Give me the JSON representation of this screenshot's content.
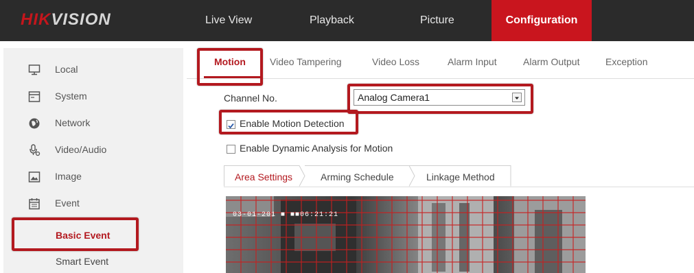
{
  "brand": {
    "logo_prefix": "HIK",
    "logo_suffix": "VISION"
  },
  "nav": {
    "live_view": "Live View",
    "playback": "Playback",
    "picture": "Picture",
    "configuration": "Configuration",
    "active": "configuration"
  },
  "sidebar": {
    "items": [
      {
        "label": "Local",
        "icon": "monitor-icon"
      },
      {
        "label": "System",
        "icon": "system-icon"
      },
      {
        "label": "Network",
        "icon": "globe-icon"
      },
      {
        "label": "Video/Audio",
        "icon": "microphone-icon"
      },
      {
        "label": "Image",
        "icon": "image-icon"
      },
      {
        "label": "Event",
        "icon": "calendar-icon"
      }
    ],
    "sub_items": [
      {
        "label": "Basic Event",
        "selected": true
      },
      {
        "label": "Smart Event",
        "selected": false
      }
    ]
  },
  "tabs": [
    "Motion",
    "Video Tampering",
    "Video Loss",
    "Alarm Input",
    "Alarm Output",
    "Exception"
  ],
  "active_tab": "Motion",
  "form": {
    "channel_label": "Channel No.",
    "channel_value": "Analog Camera1",
    "enable_motion_label": "Enable Motion Detection",
    "enable_motion_checked": true,
    "enable_dynamic_label": "Enable Dynamic Analysis for Motion",
    "enable_dynamic_checked": false
  },
  "sub_tabs": [
    "Area Settings",
    "Arming Schedule",
    "Linkage Method"
  ],
  "active_sub_tab": "Area Settings",
  "video": {
    "timestamp": "03-01-201 ■ ■■06:21:21"
  },
  "colors": {
    "accent": "#c9151e",
    "highlight": "#b3191f",
    "topbar": "#2b2b2b",
    "sidebar": "#f1f1f1"
  }
}
